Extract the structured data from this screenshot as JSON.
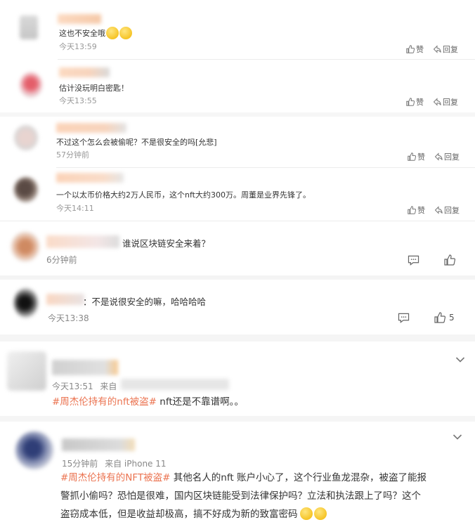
{
  "comments": [
    {
      "text": "这也不安全哦",
      "time": "今天13:59",
      "like": "赞",
      "reply": "回复"
    },
    {
      "text": "估计没玩明白密匙！",
      "time": "今天13:55",
      "like": "赞",
      "reply": "回复"
    },
    {
      "text": "不过这个怎么会被偷呢？不是很安全的吗[允悲]",
      "time": "57分钟前",
      "like": "赞",
      "reply": "回复"
    },
    {
      "text": "一个以太币价格大约2万人民币，这个nft大约300万。周董是业界先锋了。",
      "time": "今天14:11",
      "like": "赞",
      "reply": "回复"
    },
    {
      "text": "谁说区块链安全来着？",
      "time": "6分钟前"
    },
    {
      "text": "：不是说很安全的嘛，哈哈哈哈",
      "time": "今天13:38",
      "like_count": "5"
    }
  ],
  "posts": [
    {
      "time": "今天13:51",
      "source_label": "来自",
      "topic": "#周杰伦持有的nft被盗#",
      "text": " nft还是不靠谱啊。。"
    },
    {
      "time": "15分钟前",
      "source": "来自 iPhone 11",
      "topic": "#周杰伦持有的NFT被盗#",
      "line1": " 其他名人的nft 账户小心了，这个行业鱼龙混杂，被盗了能报",
      "line2": "警抓小偷吗？恐怕是很难，国内区块链能受到法律保护吗？立法和执法跟上了吗？这个",
      "line3": "盗窃成本低，但是收益却极高，搞不好成为新的致富密码"
    }
  ],
  "colors": {
    "topic": "#eb7350",
    "muted": "#999999",
    "separator": "#ececec"
  }
}
